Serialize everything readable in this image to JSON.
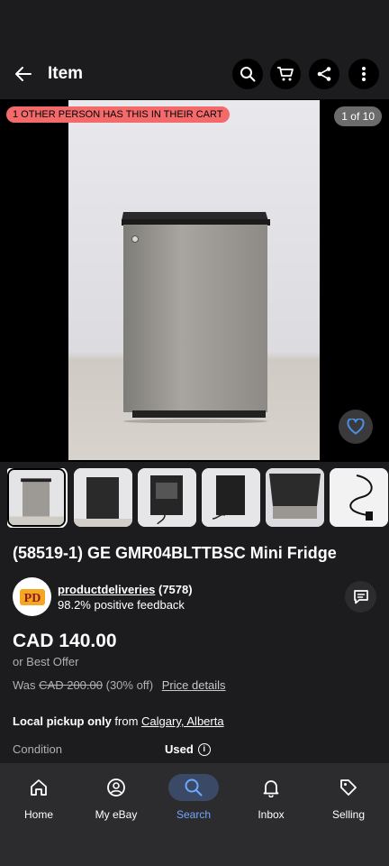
{
  "appbar": {
    "title": "Item",
    "icons": [
      "back-arrow-icon",
      "search-icon",
      "cart-icon",
      "share-icon",
      "more-vertical-icon"
    ]
  },
  "gallery": {
    "banner": "1 OTHER PERSON HAS THIS IN THEIR CART",
    "counter": "1 of 10",
    "thumbnail_count_visible": 6,
    "selected_index": 0
  },
  "item": {
    "title": "(58519-1) GE GMR04BLTTBSC Mini Fridge",
    "price": "CAD 140.00",
    "best_offer": "or Best Offer",
    "was_label": "Was",
    "was_price": "CAD 200.00",
    "discount": "(30% off)",
    "price_details": "Price details"
  },
  "seller": {
    "name": "productdeliveries",
    "count": "(7578)",
    "feedback": "98.2% positive feedback",
    "logo_text": "PD"
  },
  "shipping": {
    "pickup_bold": "Local pickup only",
    "from": "from",
    "location": "Calgary, Alberta"
  },
  "condition": {
    "label": "Condition",
    "value": "Used"
  },
  "bottom_nav": [
    {
      "label": "Home",
      "icon": "home-icon",
      "active": false
    },
    {
      "label": "My eBay",
      "icon": "profile-icon",
      "active": false
    },
    {
      "label": "Search",
      "icon": "search-icon",
      "active": true
    },
    {
      "label": "Inbox",
      "icon": "bell-icon",
      "active": false
    },
    {
      "label": "Selling",
      "icon": "tag-icon",
      "active": false
    }
  ],
  "colors": {
    "background": "#1c1c1e",
    "banner": "#f46a6a",
    "accent": "#6fa8ff",
    "heart": "#4a90e2"
  }
}
